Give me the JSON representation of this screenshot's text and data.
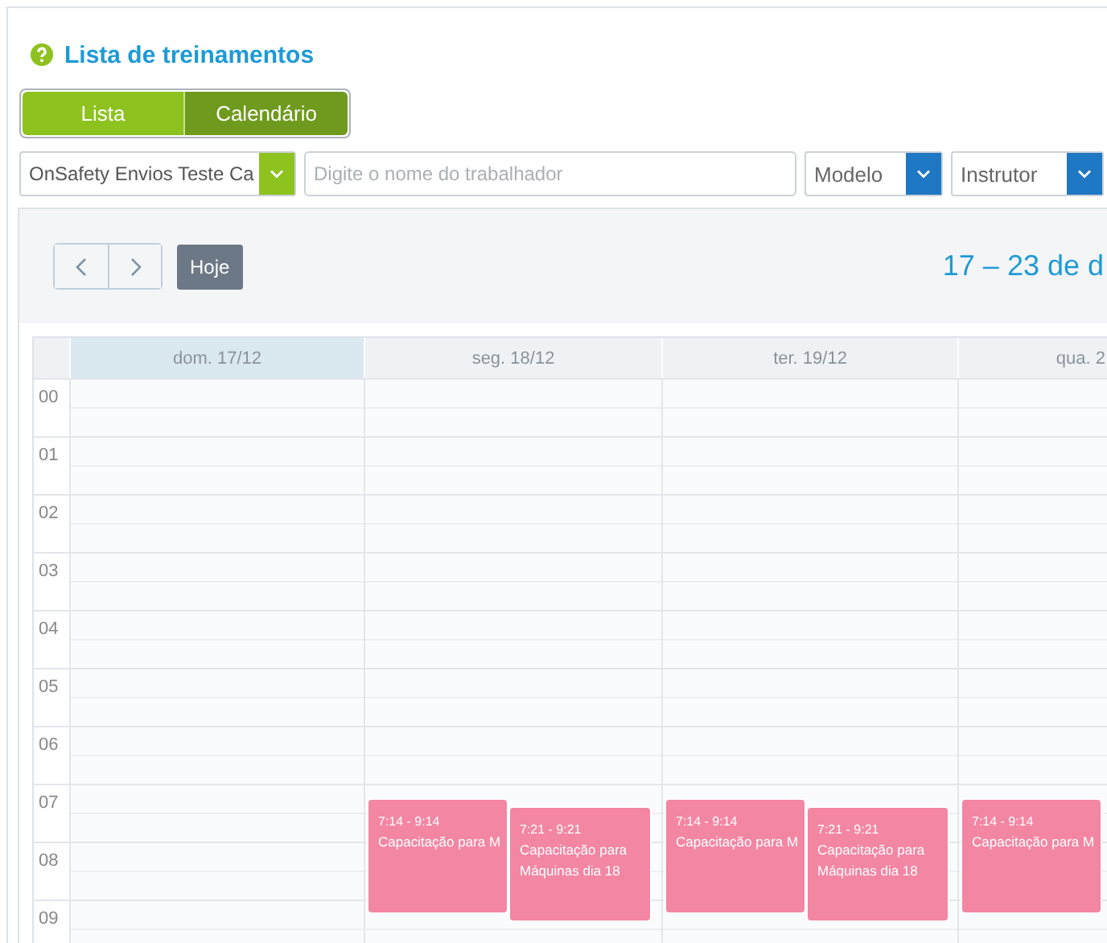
{
  "page": {
    "title": "Lista de treinamentos"
  },
  "view_toggle": [
    {
      "label": "Lista",
      "selected": false
    },
    {
      "label": "Calendário",
      "selected": true
    }
  ],
  "filters": {
    "company": {
      "value": "OnSafety Envios Teste Ca"
    },
    "worker_search": {
      "placeholder": "Digite o nome do trabalhador"
    },
    "model": {
      "value": "Modelo"
    },
    "instructor": {
      "value": "Instrutor"
    }
  },
  "calendar": {
    "today_label": "Hoje",
    "range_title": "17 – 23 de d",
    "hours": [
      "00",
      "01",
      "02",
      "03",
      "04",
      "05",
      "06",
      "07",
      "08",
      "09"
    ],
    "days": [
      {
        "label": "dom. 17/12",
        "selected": true
      },
      {
        "label": "seg. 18/12",
        "selected": false,
        "events": [
          {
            "time": "7:14 - 9:14",
            "title": "Capacitação para M"
          },
          {
            "time": "7:21 - 9:21",
            "title": "Capacitação para Máquinas dia 18"
          }
        ]
      },
      {
        "label": "ter. 19/12",
        "selected": false,
        "events": [
          {
            "time": "7:14 - 9:14",
            "title": "Capacitação para M"
          },
          {
            "time": "7:21 - 9:21",
            "title": "Capacitação para Máquinas dia 18"
          }
        ]
      },
      {
        "label": "qua. 2",
        "selected": false,
        "events": [
          {
            "time": "7:14 - 9:14",
            "title": "Capacitação para M"
          }
        ]
      }
    ]
  }
}
